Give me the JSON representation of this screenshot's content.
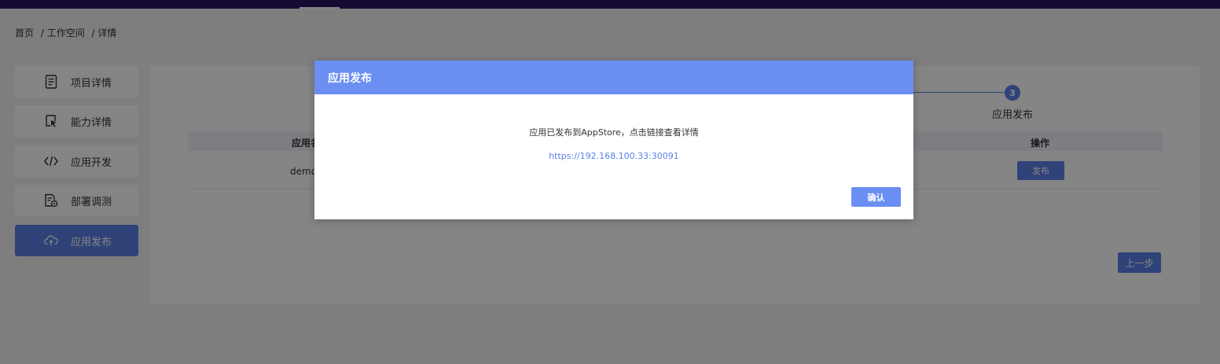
{
  "breadcrumb": {
    "items": [
      "首页",
      "/ 工作空间",
      "/ 详情"
    ]
  },
  "sidebar": {
    "items": [
      {
        "label": "项目详情",
        "icon": "document-icon"
      },
      {
        "label": "能力详情",
        "icon": "cursor-icon"
      },
      {
        "label": "应用开发",
        "icon": "code-icon"
      },
      {
        "label": "部署调测",
        "icon": "file-settings-icon"
      },
      {
        "label": "应用发布",
        "icon": "cloud-upload-icon",
        "active": true
      }
    ]
  },
  "steps": {
    "current_number": "3",
    "current_label": "应用发布"
  },
  "table": {
    "headers": [
      "应用名",
      "操作"
    ],
    "rows": [
      {
        "name": "demo",
        "action": "发布"
      }
    ]
  },
  "buttons": {
    "prev": "上一步"
  },
  "modal": {
    "title": "应用发布",
    "message": "应用已发布到AppStore，点击链接查看详情",
    "link": "https://192.168.100.33:30091",
    "confirm": "确认"
  },
  "colors": {
    "accent": "#5b80e8",
    "modal_header": "#6b8ef2",
    "topbar": "#2a1660"
  }
}
